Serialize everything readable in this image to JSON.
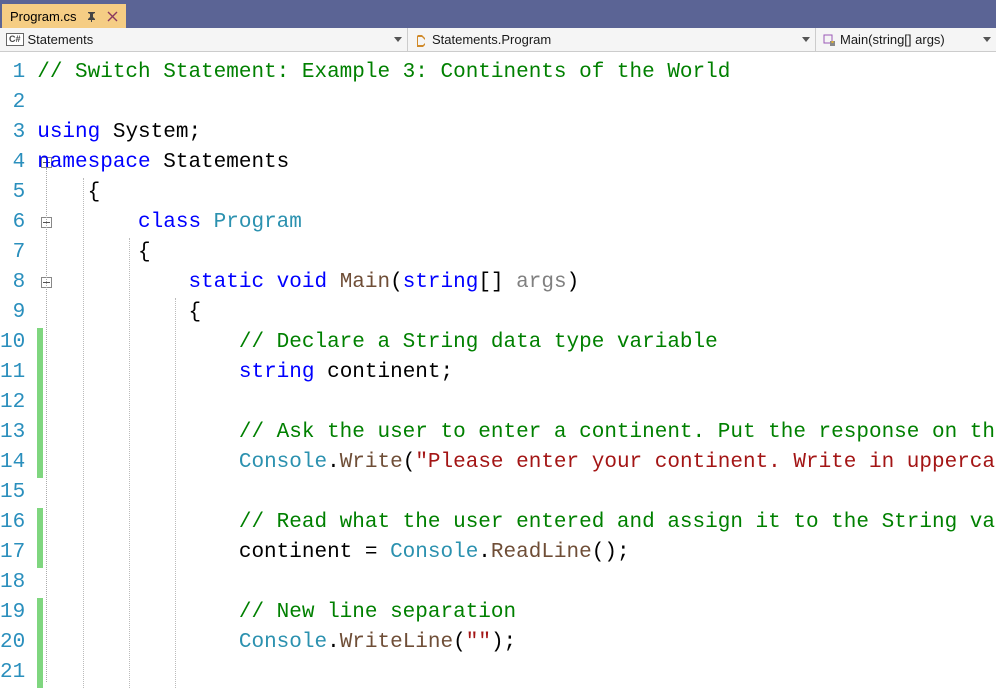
{
  "tab": {
    "title": "Program.cs"
  },
  "nav": {
    "scope": "Statements",
    "class": "Statements.Program",
    "method": "Main(string[] args)",
    "csharp_badge": "C#"
  },
  "code": {
    "lines": [
      {
        "n": 1,
        "tokens": [
          {
            "t": "// Switch Statement: Example 3: Continents of the World",
            "c": "comment"
          }
        ],
        "indent": 0
      },
      {
        "n": 2,
        "tokens": [],
        "indent": 0
      },
      {
        "n": 3,
        "tokens": [
          {
            "t": "using",
            "c": "kw"
          },
          {
            "t": " System;",
            "c": ""
          }
        ],
        "indent": 0
      },
      {
        "n": 4,
        "tokens": [
          {
            "t": "namespace",
            "c": "kw"
          },
          {
            "t": " Statements",
            "c": ""
          }
        ],
        "indent": 0
      },
      {
        "n": 5,
        "tokens": [
          {
            "t": "{",
            "c": ""
          }
        ],
        "indent": 1
      },
      {
        "n": 6,
        "tokens": [
          {
            "t": "class ",
            "c": "kw"
          },
          {
            "t": "Program",
            "c": "type"
          }
        ],
        "indent": 2
      },
      {
        "n": 7,
        "tokens": [
          {
            "t": "{",
            "c": ""
          }
        ],
        "indent": 2
      },
      {
        "n": 8,
        "tokens": [
          {
            "t": "static ",
            "c": "kw"
          },
          {
            "t": "void ",
            "c": "kw"
          },
          {
            "t": "Main",
            "c": "method"
          },
          {
            "t": "(",
            "c": ""
          },
          {
            "t": "string",
            "c": "kw"
          },
          {
            "t": "[] ",
            "c": ""
          },
          {
            "t": "args",
            "c": "param"
          },
          {
            "t": ")",
            "c": ""
          }
        ],
        "indent": 3
      },
      {
        "n": 9,
        "tokens": [
          {
            "t": "{",
            "c": ""
          }
        ],
        "indent": 3
      },
      {
        "n": 10,
        "tokens": [
          {
            "t": "// Declare a String data type variable",
            "c": "comment"
          }
        ],
        "indent": 4
      },
      {
        "n": 11,
        "tokens": [
          {
            "t": "string",
            "c": "kw"
          },
          {
            "t": " continent;",
            "c": ""
          }
        ],
        "indent": 4
      },
      {
        "n": 12,
        "tokens": [],
        "indent": 4
      },
      {
        "n": 13,
        "tokens": [
          {
            "t": "// Ask the user to enter a continent. Put the response on the same line",
            "c": "comment"
          }
        ],
        "indent": 4
      },
      {
        "n": 14,
        "tokens": [
          {
            "t": "Console",
            "c": "type"
          },
          {
            "t": ".",
            "c": ""
          },
          {
            "t": "Write",
            "c": "method"
          },
          {
            "t": "(",
            "c": ""
          },
          {
            "t": "\"Please enter your continent. Write in uppercase letters only:  \"",
            "c": "str"
          },
          {
            "t": ");",
            "c": ""
          }
        ],
        "indent": 4
      },
      {
        "n": 15,
        "tokens": [],
        "indent": 4
      },
      {
        "n": 16,
        "tokens": [
          {
            "t": "// Read what the user entered and assign it to the String variable: continent",
            "c": "comment"
          }
        ],
        "indent": 4
      },
      {
        "n": 17,
        "tokens": [
          {
            "t": "continent = ",
            "c": ""
          },
          {
            "t": "Console",
            "c": "type"
          },
          {
            "t": ".",
            "c": ""
          },
          {
            "t": "ReadLine",
            "c": "method"
          },
          {
            "t": "();",
            "c": ""
          }
        ],
        "indent": 4
      },
      {
        "n": 18,
        "tokens": [],
        "indent": 4
      },
      {
        "n": 19,
        "tokens": [
          {
            "t": "// New line separation",
            "c": "comment"
          }
        ],
        "indent": 4
      },
      {
        "n": 20,
        "tokens": [
          {
            "t": "Console",
            "c": "type"
          },
          {
            "t": ".",
            "c": ""
          },
          {
            "t": "WriteLine",
            "c": "method"
          },
          {
            "t": "(",
            "c": ""
          },
          {
            "t": "\"\"",
            "c": "str"
          },
          {
            "t": ");",
            "c": ""
          }
        ],
        "indent": 4
      },
      {
        "n": 21,
        "tokens": [],
        "indent": 4
      }
    ]
  },
  "fold_boxes": [
    4,
    6,
    8
  ],
  "change_bars": [
    [
      10,
      14
    ],
    [
      16,
      17
    ],
    [
      19,
      21
    ]
  ]
}
